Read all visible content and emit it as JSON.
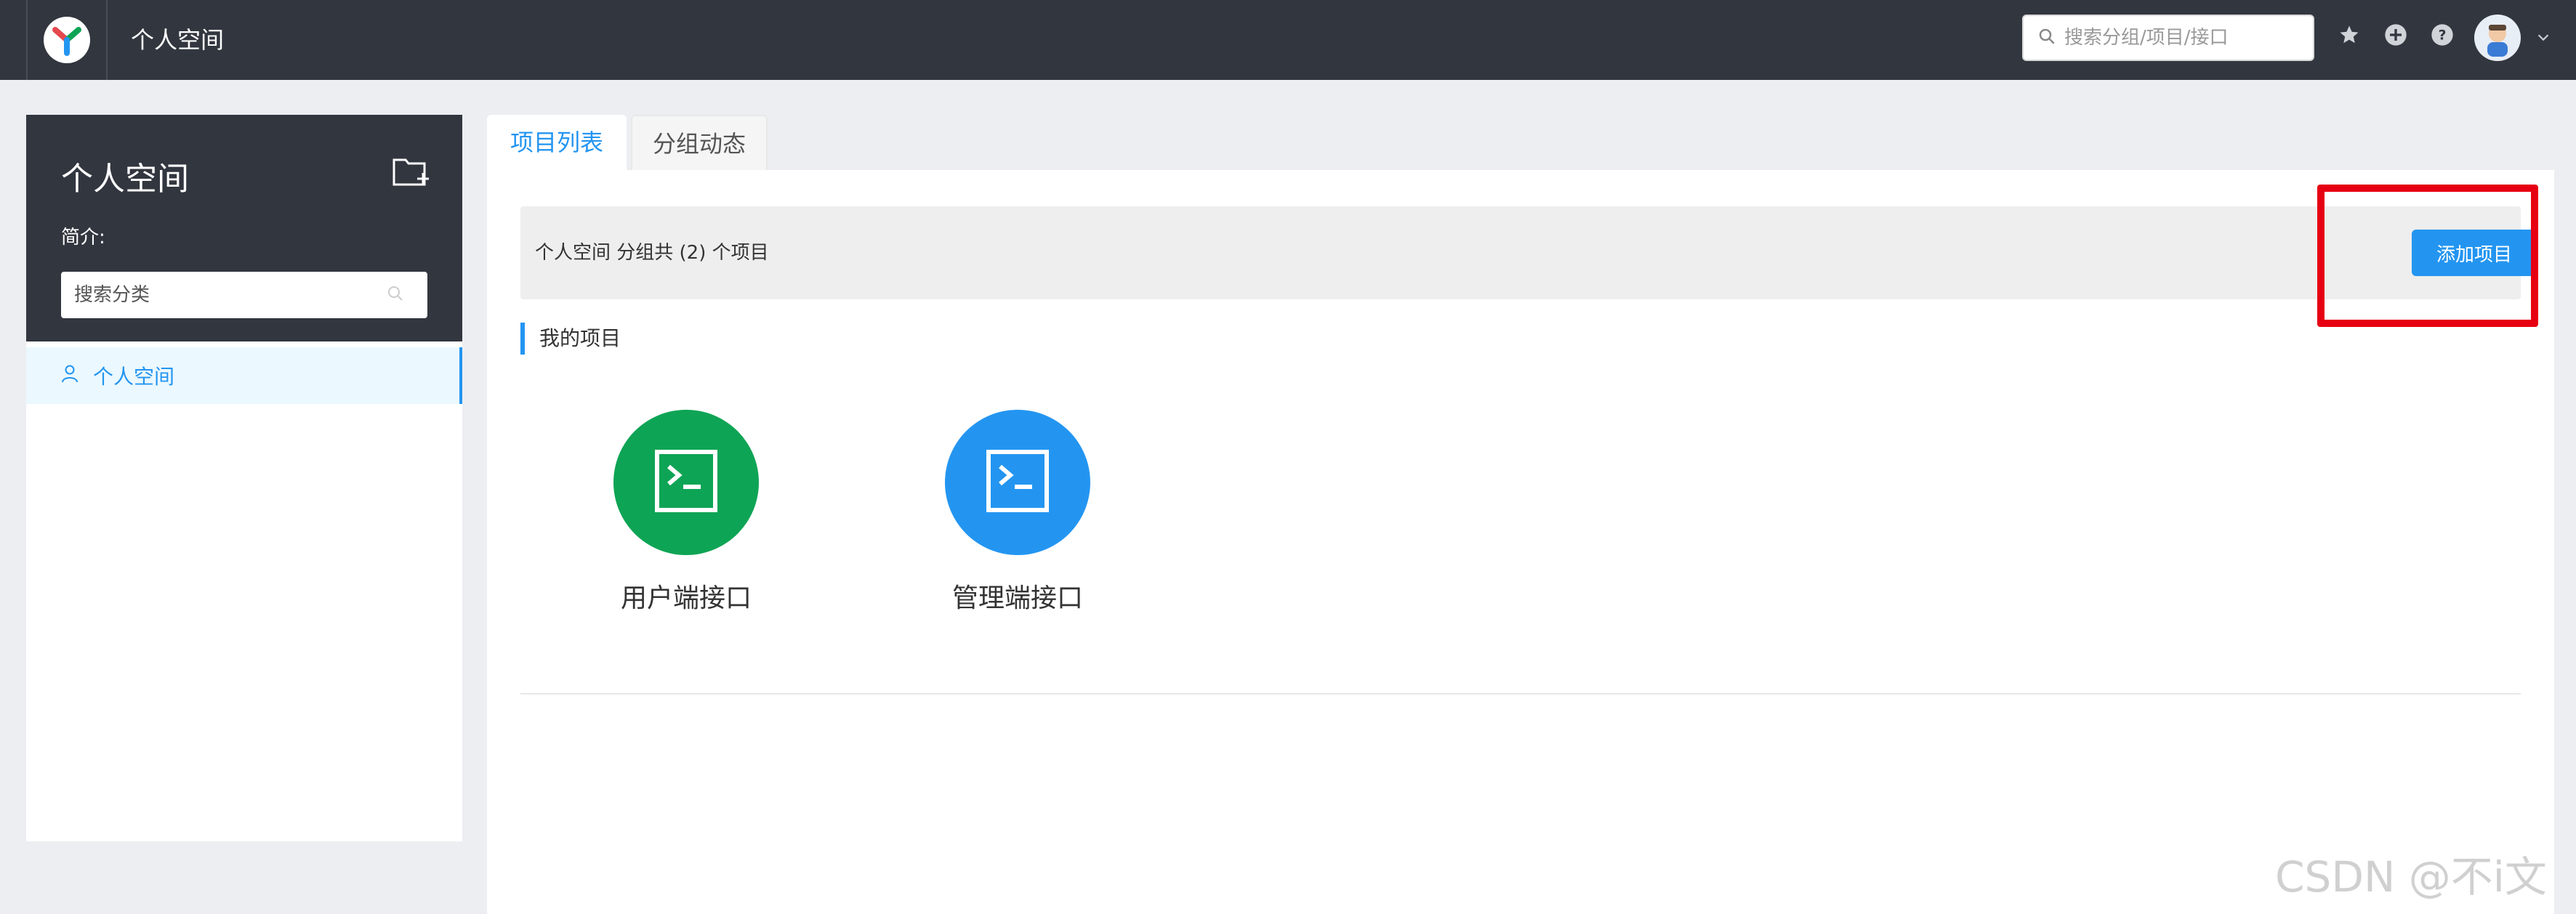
{
  "header": {
    "title": "个人空间",
    "search_placeholder": "搜索分组/项目/接口"
  },
  "sidebar": {
    "title": "个人空间",
    "intro_label": "简介:",
    "search_placeholder": "搜索分类",
    "items": [
      {
        "label": "个人空间"
      }
    ]
  },
  "tabs": [
    {
      "label": "项目列表",
      "active": true
    },
    {
      "label": "分组动态",
      "active": false
    }
  ],
  "main": {
    "summary": "个人空间 分组共 (2) 个项目",
    "add_button": "添加项目",
    "section_title": "我的项目",
    "projects": [
      {
        "name": "用户端接口",
        "color": "#0ea455"
      },
      {
        "name": "管理端接口",
        "color": "#2395f1"
      }
    ]
  },
  "watermark": "CSDN @不i文",
  "colors": {
    "accent": "#2395f1",
    "header_bg": "#32363f",
    "highlight": "#e60012"
  }
}
